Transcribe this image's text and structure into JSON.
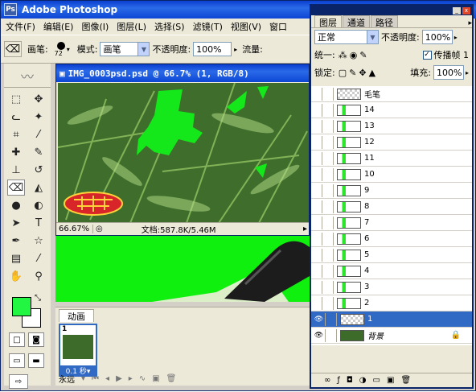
{
  "app": {
    "title": "Adobe Photoshop",
    "logo": "Ps"
  },
  "menu": [
    "文件(F)",
    "编辑(E)",
    "图像(I)",
    "图层(L)",
    "选择(S)",
    "滤镜(T)",
    "视图(V)",
    "窗口"
  ],
  "options": {
    "brush_label": "画笔:",
    "brush_size": "72",
    "mode_label": "模式:",
    "mode_value": "画笔",
    "opacity_label": "不透明度:",
    "opacity_value": "100%",
    "flow_label": "流量:"
  },
  "document": {
    "title": "IMG_0003psd.psd @ 66.7% (1, RGB/8)",
    "zoom": "66.67%",
    "doc_info": "文档:587.8K/5.46M"
  },
  "animation": {
    "tab_label": "动画",
    "frame_number": "1",
    "frame_time": "0.1 秒▾",
    "loop_value": "永远"
  },
  "layers_panel": {
    "tabs": [
      "图层",
      "通道",
      "路径"
    ],
    "blend_mode": "正常",
    "opacity_label": "不透明度:",
    "opacity_value": "100%",
    "unify_label": "统一:",
    "propagate_label": "传播帧 1",
    "lock_label": "锁定:",
    "fill_label": "填充:",
    "fill_value": "100%",
    "layers": [
      {
        "name": "毛笔",
        "thumb": "checker"
      },
      {
        "name": "14",
        "thumb": "green"
      },
      {
        "name": "13",
        "thumb": "green"
      },
      {
        "name": "12",
        "thumb": "green"
      },
      {
        "name": "11",
        "thumb": "green"
      },
      {
        "name": "10",
        "thumb": "green"
      },
      {
        "name": "9",
        "thumb": "green"
      },
      {
        "name": "8",
        "thumb": "green"
      },
      {
        "name": "7",
        "thumb": "green"
      },
      {
        "name": "6",
        "thumb": "green"
      },
      {
        "name": "5",
        "thumb": "green"
      },
      {
        "name": "4",
        "thumb": "green"
      },
      {
        "name": "3",
        "thumb": "green"
      },
      {
        "name": "2",
        "thumb": "green"
      },
      {
        "name": "1",
        "thumb": "checker"
      },
      {
        "name": "背景",
        "thumb": "image"
      }
    ]
  },
  "colors": {
    "foreground": "#22f542",
    "background": "#ffffff",
    "accent": "#316ac5"
  }
}
